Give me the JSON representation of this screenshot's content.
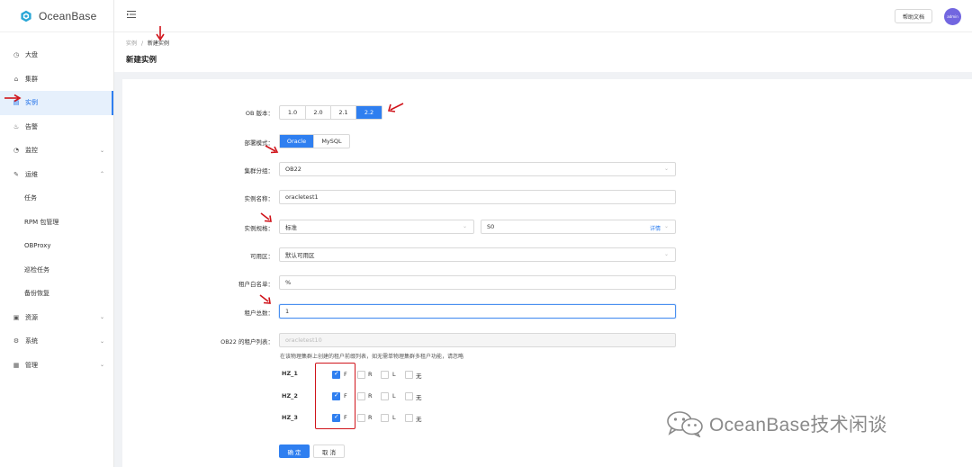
{
  "app": {
    "logo_text": "OceanBase"
  },
  "sidebar": {
    "items": [
      {
        "label": "大盘",
        "icon": "dashboard-icon"
      },
      {
        "label": "集群",
        "icon": "cluster-icon"
      },
      {
        "label": "实例",
        "icon": "instance-icon",
        "active": true
      },
      {
        "label": "告警",
        "icon": "alarm-icon"
      },
      {
        "label": "监控",
        "icon": "monitor-icon",
        "expand": "collapsed"
      },
      {
        "label": "运维",
        "icon": "ops-icon",
        "expand": "expanded"
      },
      {
        "label": "任务",
        "sub": true
      },
      {
        "label": "RPM 包管理",
        "sub": true
      },
      {
        "label": "OBProxy",
        "sub": true
      },
      {
        "label": "巡检任务",
        "sub": true
      },
      {
        "label": "备份恢复",
        "sub": true
      },
      {
        "label": "资源",
        "icon": "resource-icon",
        "expand": "collapsed"
      },
      {
        "label": "系统",
        "icon": "system-icon",
        "expand": "collapsed"
      },
      {
        "label": "管理",
        "icon": "manage-icon",
        "expand": "collapsed"
      }
    ]
  },
  "header": {
    "help_label": "帮助文档",
    "avatar_text": "admin"
  },
  "breadcrumb": {
    "parent": "实例",
    "sep": "/",
    "current": "新建实例"
  },
  "page_title": "新建实例",
  "form": {
    "ob_version": {
      "label": "OB 版本：",
      "options": [
        "1.0",
        "2.0",
        "2.1",
        "2.2"
      ],
      "selected": "2.2"
    },
    "deploy_mode": {
      "label": "部署模式：",
      "options": [
        "Oracle",
        "MySQL"
      ],
      "selected": "Oracle"
    },
    "cluster_group": {
      "label": "集群分组：",
      "value": "OB22"
    },
    "instance_name": {
      "label": "实例名称：",
      "value": "oracletest1"
    },
    "instance_spec": {
      "label": "实例规格：",
      "value": "标准",
      "value2": "S0",
      "link": "详情"
    },
    "zone": {
      "label": "可用区：",
      "value": "默认可用区"
    },
    "tenant_whitelist": {
      "label": "租户白名单：",
      "value": "%"
    },
    "tenant_total": {
      "label": "租户总数：",
      "value": "1"
    },
    "tenant_list": {
      "label": "OB22 的租户列表：",
      "placeholder": "oracletest10"
    },
    "hint": "在该物理集群上创建的租户前缀列表，如无需单物理集群多租户功能，请忽略",
    "zones": [
      {
        "name": "HZ_1",
        "options": [
          {
            "label": "F",
            "checked": true
          },
          {
            "label": "R",
            "checked": false
          },
          {
            "label": "L",
            "checked": false
          },
          {
            "label": "无",
            "checked": false
          }
        ]
      },
      {
        "name": "HZ_2",
        "options": [
          {
            "label": "F",
            "checked": true
          },
          {
            "label": "R",
            "checked": false
          },
          {
            "label": "L",
            "checked": false
          },
          {
            "label": "无",
            "checked": false
          }
        ]
      },
      {
        "name": "HZ_3",
        "options": [
          {
            "label": "F",
            "checked": true
          },
          {
            "label": "R",
            "checked": false
          },
          {
            "label": "L",
            "checked": false
          },
          {
            "label": "无",
            "checked": false
          }
        ]
      }
    ],
    "confirm_label": "确 定",
    "cancel_label": "取 消"
  },
  "watermark": {
    "text": "OceanBase技术闲谈",
    "icon": "wechat-icon"
  },
  "colors": {
    "primary": "#2f7ff0",
    "annotation_red": "#d0141b",
    "avatar": "#7266e0"
  }
}
